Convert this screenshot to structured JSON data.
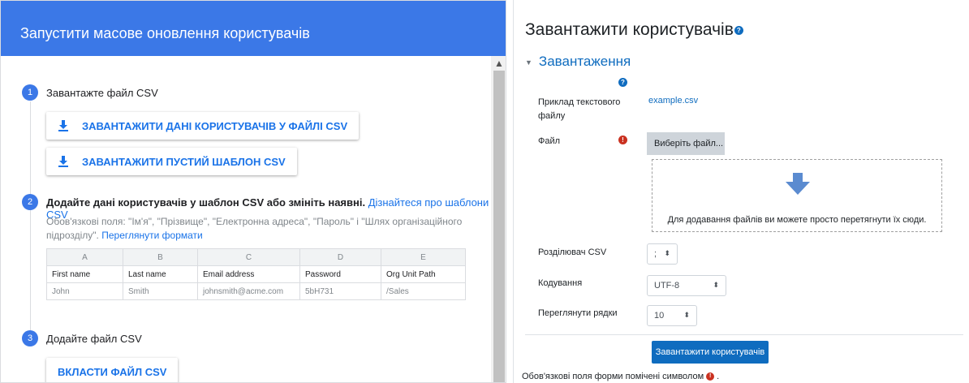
{
  "left": {
    "header_title": "Запустити масове оновлення користувачів",
    "step1": {
      "num": "1",
      "title": "Завантажте файл CSV",
      "download_data_label": "ЗАВАНТАЖИТИ ДАНІ КОРИСТУВАЧІВ У ФАЙЛІ CSV",
      "download_template_label": "ЗАВАНТАЖИТИ ПУСТИЙ ШАБЛОН CSV"
    },
    "step2": {
      "num": "2",
      "title": "Додайте дані користувачів у шаблон CSV або змініть наявні.",
      "title_link": "Дізнайтеся про шаблони CSV",
      "note": "Обов'язкові поля: \"Ім'я\", \"Прізвище\", \"Електронна адреса\", \"Пароль\" і \"Шлях організаційного підрозділу\".",
      "note_link": "Переглянути формати",
      "sheet": {
        "columns": [
          "A",
          "B",
          "C",
          "D",
          "E"
        ],
        "rows": [
          [
            "First name",
            "Last name",
            "Email address",
            "Password",
            "Org Unit Path"
          ],
          [
            "John",
            "Smith",
            "johnsmith@acme.com",
            "5bH731",
            "/Sales"
          ]
        ]
      }
    },
    "step3": {
      "num": "3",
      "title": "Додайте файл CSV",
      "attach_label": "ВКЛАСТИ ФАЙЛ CSV"
    },
    "colors": {
      "header": "#3b78e7",
      "accent": "#1a73e8"
    }
  },
  "right": {
    "title": "Завантажити користувачів",
    "section": "Завантаження",
    "example_label": "Приклад текстового файлу",
    "example_link": "example.csv",
    "file_label": "Файл",
    "choose_file": "Виберіть файл...",
    "drop_text": "Для додавання файлів ви можете просто перетягнути їх сюди.",
    "delimiter_label": "Розділювач CSV",
    "delimiter_value": ";",
    "encoding_label": "Кодування",
    "encoding_value": "UTF-8",
    "preview_label": "Переглянути рядки",
    "preview_value": "10",
    "submit_label": "Завантажити користувачів",
    "required_note": "Обов'язкові поля форми помічені символом",
    "colors": {
      "primary": "#0f6cbf",
      "required": "#ca3120"
    }
  }
}
